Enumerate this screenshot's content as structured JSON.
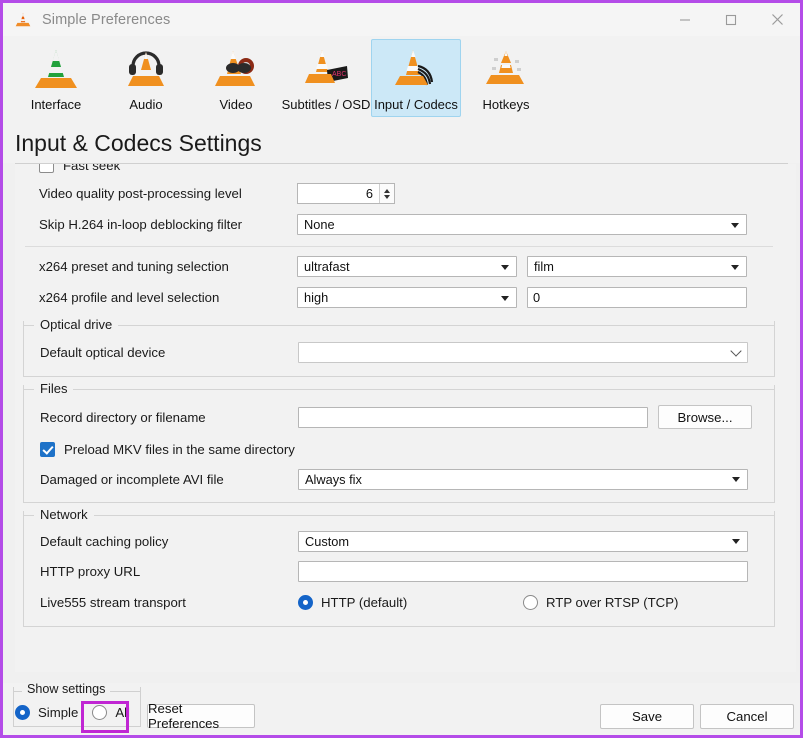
{
  "window": {
    "title": "Simple Preferences",
    "icon": "vlc-cone-icon",
    "border_color": "#b44ce8",
    "controls": {
      "minimize": "minimize-icon",
      "maximize": "maximize-icon",
      "close": "close-icon"
    }
  },
  "toolbar": {
    "items": [
      {
        "label": "Interface",
        "icon": "vlc-cone-interface-icon",
        "selected": false
      },
      {
        "label": "Audio",
        "icon": "vlc-cone-audio-icon",
        "selected": false
      },
      {
        "label": "Video",
        "icon": "vlc-cone-video-icon",
        "selected": false
      },
      {
        "label": "Subtitles / OSD",
        "icon": "vlc-cone-subtitles-icon",
        "selected": false
      },
      {
        "label": "Input / Codecs",
        "icon": "vlc-cone-input-codecs-icon",
        "selected": true
      },
      {
        "label": "Hotkeys",
        "icon": "vlc-cone-hotkeys-icon",
        "selected": false
      }
    ],
    "selected_index": 4,
    "selected_bg": "#cce8f7"
  },
  "page": {
    "heading": "Input & Codecs Settings"
  },
  "codecs": {
    "fast_seek": {
      "label": "Fast seek",
      "checked": false
    },
    "post_processing": {
      "label": "Video quality post-processing level",
      "value": "6"
    },
    "deblocking": {
      "label": "Skip H.264 in-loop deblocking filter",
      "value": "None"
    },
    "x264_preset": {
      "label": "x264 preset and tuning selection",
      "preset_value": "ultrafast",
      "tuning_value": "film"
    },
    "x264_profile": {
      "label": "x264 profile and level selection",
      "profile_value": "high",
      "level_value": "0"
    }
  },
  "optical_drive": {
    "title": "Optical drive",
    "default_device": {
      "label": "Default optical device",
      "value": ""
    }
  },
  "files": {
    "title": "Files",
    "record_directory": {
      "label": "Record directory or filename",
      "value": ""
    },
    "browse_label": "Browse...",
    "preload_mkv": {
      "label": "Preload MKV files in the same directory",
      "checked": true
    },
    "avi": {
      "label": "Damaged or incomplete AVI file",
      "value": "Always fix"
    }
  },
  "network": {
    "title": "Network",
    "caching": {
      "label": "Default caching policy",
      "value": "Custom"
    },
    "proxy": {
      "label": "HTTP proxy URL",
      "value": ""
    },
    "live555": {
      "label": "Live555 stream transport",
      "options": [
        {
          "label": "HTTP (default)",
          "selected": true
        },
        {
          "label": "RTP over RTSP (TCP)",
          "selected": false
        }
      ]
    }
  },
  "bottom": {
    "show_settings": {
      "title": "Show settings",
      "options": [
        {
          "label": "Simple",
          "selected": true
        },
        {
          "label": "All",
          "selected": false
        }
      ]
    },
    "reset_label": "Reset Preferences",
    "save_label": "Save",
    "cancel_label": "Cancel",
    "highlight_color": "#c026d3",
    "highlight_target": "All"
  }
}
